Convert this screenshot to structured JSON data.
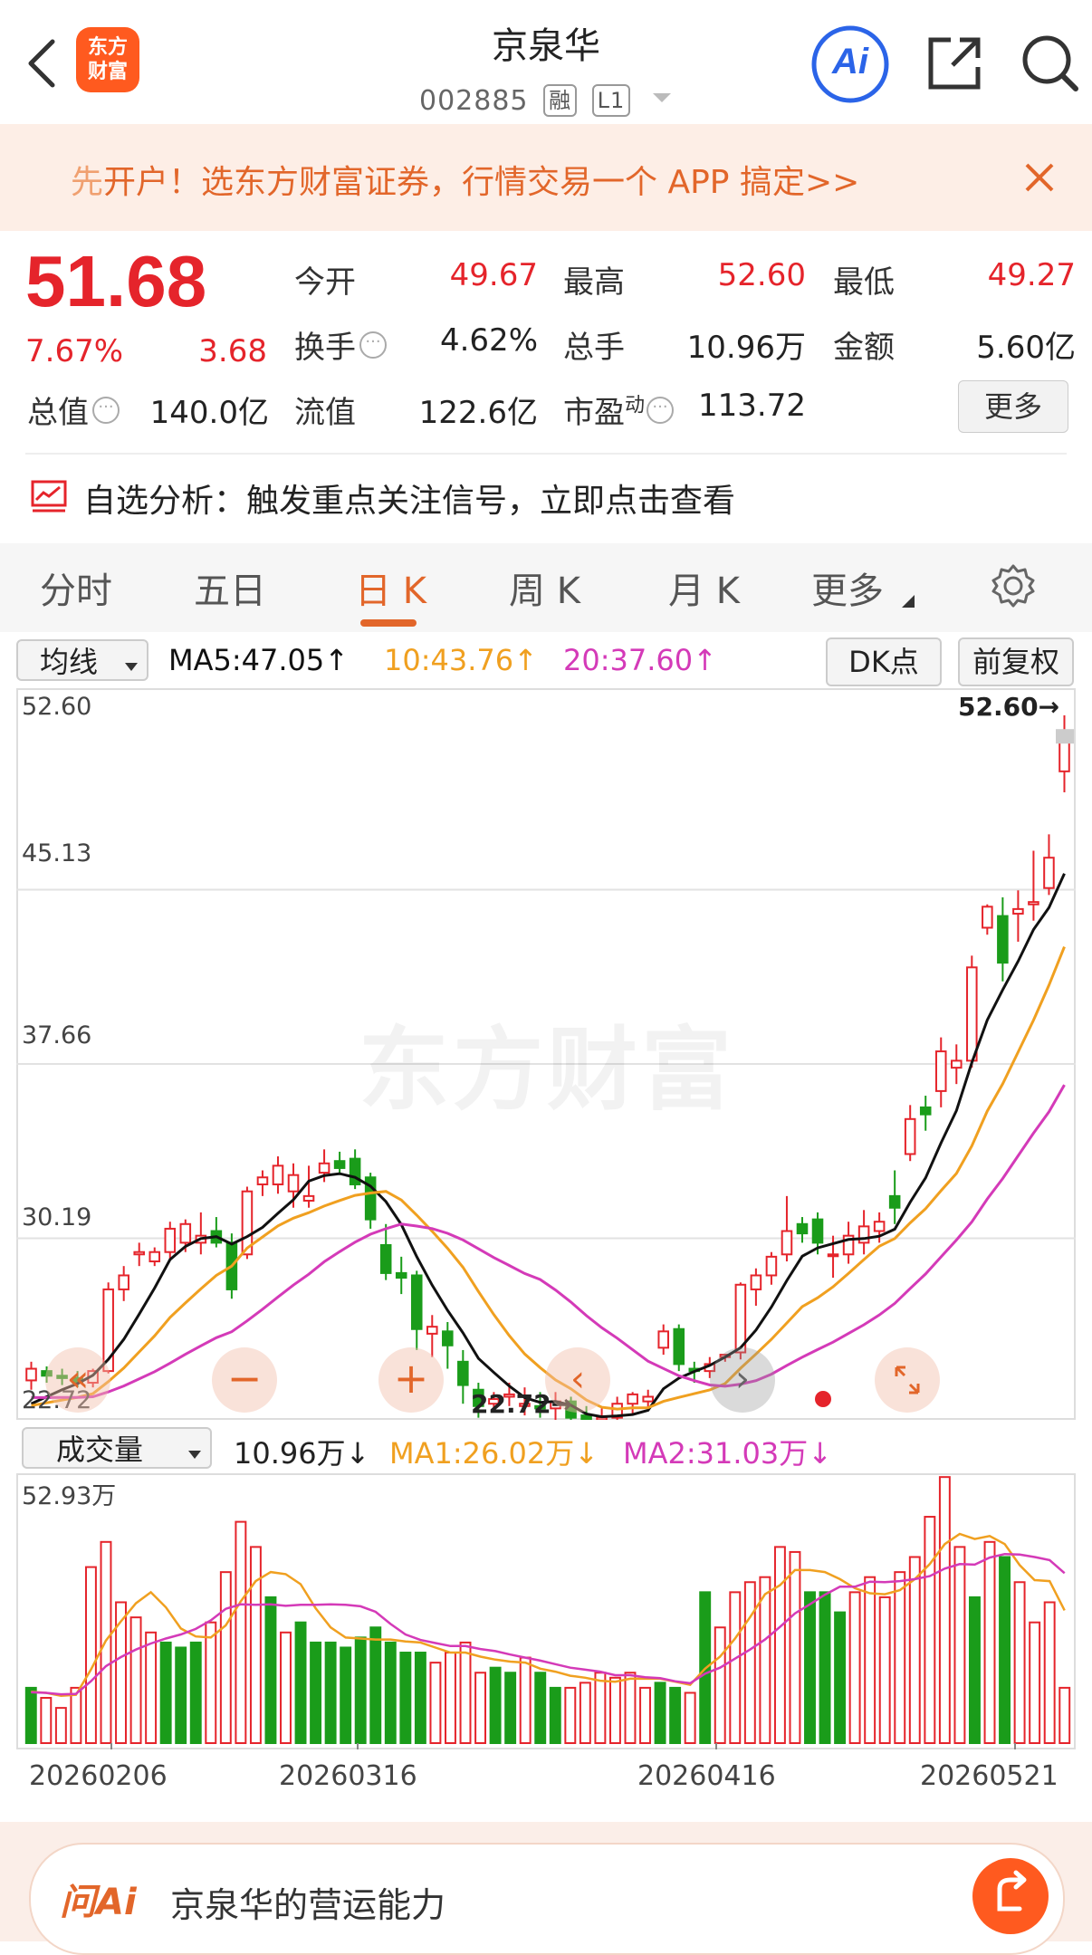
{
  "header": {
    "logo_line1": "东方",
    "logo_line2": "财富",
    "title": "京泉华",
    "code": "002885",
    "tag1": "融",
    "tag2": "L1",
    "ai_label": "Ai"
  },
  "banner": {
    "text_accent": "先",
    "text": "开户！选东方财富证券，行情交易一个 APP 搞定>>"
  },
  "quote": {
    "price": "51.68",
    "change_pct": "7.67%",
    "change": "3.68",
    "rows": [
      [
        {
          "label": "今开",
          "value": "49.67",
          "red": true
        },
        {
          "label": "最高",
          "value": "52.60",
          "red": true
        },
        {
          "label": "最低",
          "value": "49.27",
          "red": true
        }
      ],
      [
        {
          "label": "换手",
          "value": "4.62%",
          "red": false
        },
        {
          "label": "总手",
          "value": "10.96万",
          "red": false
        },
        {
          "label": "金额",
          "value": "5.60亿",
          "red": false
        }
      ],
      [
        {
          "label": "流值",
          "value": "122.6亿",
          "red": false
        },
        {
          "label": "市盈",
          "sup": "动",
          "value": "113.72",
          "red": false
        }
      ]
    ],
    "total_label": "总值",
    "total_value": "140.0亿",
    "more_label": "更多"
  },
  "analysis": {
    "text": "自选分析：触发重点关注信号，立即点击查看"
  },
  "tabs": [
    "分时",
    "五日",
    "日 K",
    "周 K",
    "月 K",
    "更多"
  ],
  "active_tab": "日 K",
  "ma_bar": {
    "select": "均线",
    "ma5": "MA5:47.05",
    "ma10": "10:43.76",
    "ma20": "20:37.60",
    "dk": "DK点",
    "adjust": "前复权"
  },
  "kchart": {
    "ticks": [
      "52.60",
      "45.13",
      "37.66",
      "30.19",
      "22.72"
    ],
    "high_label": "52.60→",
    "low_label": "22.72→",
    "watermark": "东方财富"
  },
  "volume_bar": {
    "select": "成交量",
    "vol": "10.96万",
    "ma1": "MA1:26.02万",
    "ma2": "MA2:31.03万",
    "max_label": "52.93万"
  },
  "dates": [
    "20260206",
    "20260316",
    "20260416",
    "20260521"
  ],
  "ai": {
    "brand": "问Ai",
    "text": "京泉华的营运能力"
  },
  "colors": {
    "up": "#e5242b",
    "down": "#1a9c1a",
    "ma5": "#111111",
    "ma10": "#f0a020",
    "ma20": "#d43ab8",
    "accent": "#e2662a"
  },
  "chart_data": {
    "type": "candlestick",
    "y_range": [
      22.72,
      52.6
    ],
    "ma5_current": 47.05,
    "ma10_current": 43.76,
    "ma20_current": 37.6,
    "high": 52.6,
    "low": 22.72,
    "candles": [
      [
        24.1,
        24.9,
        23.7,
        24.6
      ],
      [
        24.5,
        24.7,
        24.0,
        24.3
      ],
      [
        24.3,
        24.6,
        23.9,
        24.2
      ],
      [
        24.2,
        24.5,
        23.8,
        24.0
      ],
      [
        24.0,
        24.6,
        23.8,
        24.5
      ],
      [
        24.5,
        28.3,
        24.4,
        28.0
      ],
      [
        28.0,
        29.0,
        27.5,
        28.6
      ],
      [
        29.5,
        30.0,
        29.0,
        29.6
      ],
      [
        29.2,
        29.8,
        29.0,
        29.6
      ],
      [
        29.6,
        30.9,
        29.3,
        30.6
      ],
      [
        30.0,
        31.0,
        29.6,
        30.8
      ],
      [
        30.0,
        31.3,
        29.5,
        30.3
      ],
      [
        30.5,
        31.1,
        29.8,
        30.0
      ],
      [
        30.0,
        30.4,
        27.6,
        28.0
      ],
      [
        29.5,
        32.4,
        29.3,
        32.2
      ],
      [
        32.5,
        33.1,
        32.0,
        32.8
      ],
      [
        32.5,
        33.7,
        32.1,
        33.3
      ],
      [
        32.2,
        33.4,
        31.5,
        32.9
      ],
      [
        31.8,
        33.3,
        31.5,
        32.0
      ],
      [
        33.0,
        34.0,
        32.6,
        33.4
      ],
      [
        33.5,
        33.9,
        32.9,
        33.2
      ],
      [
        33.6,
        34.0,
        32.3,
        32.5
      ],
      [
        32.8,
        33.0,
        30.6,
        31.0
      ],
      [
        29.9,
        30.8,
        28.4,
        28.7
      ],
      [
        28.7,
        29.4,
        27.8,
        28.5
      ],
      [
        28.6,
        28.8,
        25.4,
        26.3
      ],
      [
        26.1,
        26.9,
        25.1,
        26.4
      ],
      [
        26.2,
        26.6,
        24.6,
        25.6
      ],
      [
        24.9,
        25.4,
        23.1,
        23.9
      ],
      [
        23.7,
        24.0,
        22.5,
        23.0
      ],
      [
        23.1,
        23.6,
        22.9,
        23.3
      ],
      [
        23.4,
        24.0,
        23.0,
        23.5
      ],
      [
        23.0,
        23.8,
        22.6,
        23.1
      ],
      [
        23.0,
        23.6,
        22.5,
        22.9
      ],
      [
        22.9,
        23.6,
        22.1,
        23.2
      ],
      [
        23.2,
        23.4,
        22.3,
        22.5
      ],
      [
        22.6,
        23.0,
        21.5,
        21.6
      ],
      [
        22.4,
        22.9,
        22.0,
        22.5
      ],
      [
        22.5,
        23.4,
        22.3,
        23.1
      ],
      [
        23.1,
        23.6,
        22.6,
        23.5
      ],
      [
        23.2,
        23.7,
        22.8,
        23.4
      ],
      [
        25.5,
        26.5,
        25.2,
        26.2
      ],
      [
        26.3,
        26.5,
        24.5,
        24.8
      ],
      [
        24.6,
        24.9,
        24.0,
        24.5
      ],
      [
        24.5,
        25.1,
        24.2,
        24.8
      ],
      [
        25.1,
        25.2,
        24.9,
        25.2
      ],
      [
        25.3,
        28.3,
        25.0,
        28.2
      ],
      [
        28.0,
        28.9,
        27.3,
        28.6
      ],
      [
        28.6,
        29.6,
        28.2,
        29.4
      ],
      [
        29.5,
        32.0,
        29.2,
        30.5
      ],
      [
        30.8,
        31.1,
        30.0,
        30.4
      ],
      [
        31.0,
        31.3,
        29.5,
        30.0
      ],
      [
        29.5,
        30.3,
        28.5,
        29.5
      ],
      [
        29.5,
        30.9,
        29.1,
        30.3
      ],
      [
        30.0,
        31.4,
        29.5,
        30.7
      ],
      [
        30.5,
        31.3,
        30.0,
        30.9
      ],
      [
        32.0,
        33.1,
        30.8,
        31.5
      ],
      [
        33.8,
        35.9,
        33.5,
        35.3
      ],
      [
        35.8,
        36.3,
        34.8,
        35.5
      ],
      [
        36.5,
        38.8,
        35.8,
        38.2
      ],
      [
        37.5,
        38.5,
        36.8,
        37.8
      ],
      [
        37.8,
        42.3,
        37.5,
        41.8
      ],
      [
        43.5,
        44.5,
        43.2,
        44.4
      ],
      [
        44.0,
        44.8,
        41.2,
        42.0
      ],
      [
        44.1,
        45.1,
        42.9,
        44.3
      ],
      [
        44.5,
        46.8,
        43.8,
        44.6
      ],
      [
        45.2,
        47.5,
        44.9,
        46.5
      ],
      [
        50.2,
        52.6,
        49.3,
        51.7
      ]
    ],
    "volume_max_label": "52.93万",
    "volume_current": "10.96万",
    "volume_ma1": 26.02,
    "volume_ma2": 31.03,
    "volumes": [
      [
        11,
        0
      ],
      [
        9,
        1
      ],
      [
        7,
        1
      ],
      [
        11,
        1
      ],
      [
        35,
        1
      ],
      [
        40,
        1
      ],
      [
        28,
        1
      ],
      [
        25,
        1
      ],
      [
        22,
        1
      ],
      [
        20,
        0
      ],
      [
        19,
        0
      ],
      [
        20,
        0
      ],
      [
        24,
        1
      ],
      [
        34,
        1
      ],
      [
        44,
        1
      ],
      [
        39,
        1
      ],
      [
        29,
        0
      ],
      [
        22,
        1
      ],
      [
        24,
        0
      ],
      [
        20,
        0
      ],
      [
        20,
        0
      ],
      [
        19,
        0
      ],
      [
        21,
        0
      ],
      [
        23,
        0
      ],
      [
        20,
        0
      ],
      [
        18,
        0
      ],
      [
        18,
        0
      ],
      [
        16,
        1
      ],
      [
        18,
        1
      ],
      [
        20,
        1
      ],
      [
        14,
        1
      ],
      [
        15,
        0
      ],
      [
        14,
        0
      ],
      [
        17,
        1
      ],
      [
        14,
        0
      ],
      [
        11,
        0
      ],
      [
        11,
        1
      ],
      [
        12,
        1
      ],
      [
        14,
        1
      ],
      [
        13,
        1
      ],
      [
        14,
        1
      ],
      [
        11,
        1
      ],
      [
        12,
        0
      ],
      [
        11,
        0
      ],
      [
        10,
        1
      ],
      [
        30,
        0
      ],
      [
        23,
        1
      ],
      [
        30,
        1
      ],
      [
        32,
        1
      ],
      [
        33,
        1
      ],
      [
        39,
        1
      ],
      [
        38,
        1
      ],
      [
        30,
        0
      ],
      [
        30,
        0
      ],
      [
        26,
        0
      ],
      [
        30,
        1
      ],
      [
        33,
        1
      ],
      [
        29,
        1
      ],
      [
        34,
        1
      ],
      [
        37,
        1
      ],
      [
        45,
        1
      ],
      [
        52.9,
        1
      ],
      [
        39,
        1
      ],
      [
        29,
        0
      ],
      [
        40,
        1
      ],
      [
        37,
        0
      ],
      [
        32,
        1
      ],
      [
        24,
        1
      ],
      [
        28,
        1
      ],
      [
        11,
        1
      ]
    ]
  }
}
